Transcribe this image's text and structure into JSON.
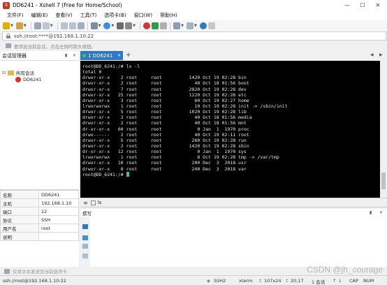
{
  "window": {
    "title": "DD6241 - Xshell 7 (Free for Home/School)",
    "app_icon": "xshell-icon"
  },
  "menu": [
    "文件(F)",
    "编辑(E)",
    "查看(V)",
    "工具(T)",
    "选项卡(B)",
    "窗口(W)",
    "帮助(H)"
  ],
  "address": {
    "value": "ssh://root:****@192.168.1.10:22"
  },
  "hint": "要添加当前会话，点击左侧的箭头按钮。",
  "session_manager": {
    "title": "会话管理器",
    "root": "所有会话",
    "child": "DD6241"
  },
  "properties": [
    {
      "key": "名称",
      "value": "DD6241"
    },
    {
      "key": "主机",
      "value": "192.168.1.10"
    },
    {
      "key": "端口",
      "value": "22"
    },
    {
      "key": "协议",
      "value": "SSH"
    },
    {
      "key": "用户名",
      "value": "root"
    },
    {
      "key": "说明",
      "value": ""
    }
  ],
  "tab": {
    "label": "1 DD6241",
    "new_tab": "+"
  },
  "terminal": {
    "lines": [
      "root@DD_6241:/# ls -l",
      "total 0",
      "drwxr-xr-x    2 root     root          1420 Oct 19 02:28 bin",
      "drwxr-xr-x    2 root     root            40 Oct 18 01:56 boot",
      "drwxr-xr-x    7 root     root          2820 Oct 19 02:28 dev",
      "drwxr-xr-x   25 root     root          1220 Oct 19 02:28 etc",
      "drwxr-xr-x    3 root     root            60 Oct 19 02:27 home",
      "lrwxrwxrwx    1 root     root            10 Oct 19 02:28 init -> /sbin/init",
      "drwxr-xr-x    5 root     root          1020 Oct 19 02:28 lib",
      "drwxr-xr-x    2 root     root            40 Oct 18 01:56 media",
      "drwxr-xr-x    2 root     root            40 Oct 18 01:56 mnt",
      "dr-xr-xr-x   60 root     root             0 Jan  1  1970 proc",
      "drwx------    2 root     root            40 Oct 19 02:11 root",
      "drwxr-xr-x    5 root     root           260 Oct 19 02:28 run",
      "drwxr-xr-x    2 root     root          1420 Oct 19 02:28 sbin",
      "dr-xr-xr-x   12 root     root             0 Jan  1  1970 sys",
      "lrwxrwxrwx    1 root     root             8 Oct 19 02:28 tmp -> /var/tmp",
      "drwxr-xr-x   10 root     root           200 Dec  3  2018 usr",
      "drwxr-xr-x    8 root     root           240 Dec  3  2018 var"
    ],
    "prompt": "root@DD_6241:/# "
  },
  "quickbar": {
    "label": "ls"
  },
  "compose": {
    "title": "撰写"
  },
  "input_hint": "仅将文本发送到当前选项卡",
  "status": {
    "conn": "ssh://root@192.168.1.10:22",
    "proto": "SSH2",
    "term": "xterm",
    "size": "107x24",
    "pos": "20,17",
    "sessions": "1 会话",
    "caps": "CAP",
    "num": "NUM"
  },
  "watermark": "CSDN @jh_courage",
  "colors": {
    "accent": "#2f78c4",
    "terminal_bg": "#000000",
    "terminal_fg": "#e8e8e8",
    "cursor": "#2ecc71"
  }
}
